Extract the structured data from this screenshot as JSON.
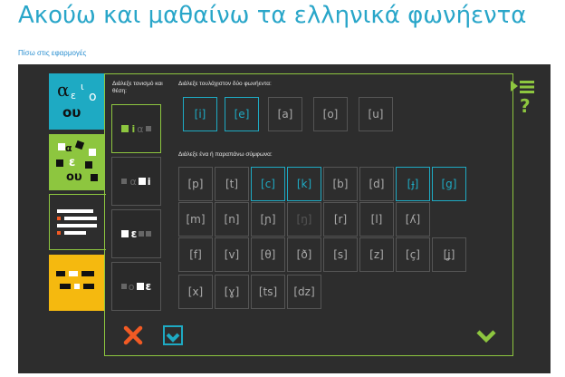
{
  "title": "Ακούω και μαθαίνω τα ελληνικά φωνήεντα",
  "back_link": "Πίσω στις εφαρμογές",
  "accent_label": "Διάλεξε τονισμό και θέση:",
  "vowels_label": "Διάλεξε τουλάχιστον δύο φωνήεντα:",
  "consonants_label": "Διάλεξε ένα ή παραπάνω σύμφωνα:",
  "tile1": {
    "line1": "α",
    "line2": "ε",
    "line3": "ι",
    "line4": "ο",
    "line5": "ου"
  },
  "tile2": {
    "a": "α",
    "b": "ε",
    "c": "ου"
  },
  "accent_options": [
    {
      "text": "i",
      "mid": "α",
      "selected": true
    },
    {
      "text": "α",
      "mid": "i",
      "selected": false
    },
    {
      "text": "ε",
      "mid": "",
      "selected": false
    },
    {
      "text": "ο",
      "mid": "ε",
      "selected": false
    }
  ],
  "vowels": [
    {
      "label": "[i]",
      "selected": true
    },
    {
      "label": "[e]",
      "selected": true
    },
    {
      "label": "[a]",
      "selected": false
    },
    {
      "label": "[o]",
      "selected": false
    },
    {
      "label": "[u]",
      "selected": false
    }
  ],
  "consonants": [
    [
      {
        "label": "[p]",
        "state": "normal"
      },
      {
        "label": "[t]",
        "state": "normal"
      },
      {
        "label": "[c]",
        "state": "selected"
      },
      {
        "label": "[k]",
        "state": "selected"
      },
      {
        "label": "[b]",
        "state": "normal"
      },
      {
        "label": "[d]",
        "state": "normal"
      },
      {
        "label": "[ɟ]",
        "state": "selected"
      },
      {
        "label": "[g]",
        "state": "selected"
      }
    ],
    [
      {
        "label": "[m]",
        "state": "normal"
      },
      {
        "label": "[n]",
        "state": "normal"
      },
      {
        "label": "[ɲ]",
        "state": "normal"
      },
      {
        "label": "[ŋ]",
        "state": "disabled"
      },
      {
        "label": "[r]",
        "state": "normal"
      },
      {
        "label": "[l]",
        "state": "normal"
      },
      {
        "label": "[ʎ]",
        "state": "normal"
      }
    ],
    [
      {
        "label": "[f]",
        "state": "normal"
      },
      {
        "label": "[v]",
        "state": "normal"
      },
      {
        "label": "[θ]",
        "state": "normal"
      },
      {
        "label": "[ð]",
        "state": "normal"
      },
      {
        "label": "[s]",
        "state": "normal"
      },
      {
        "label": "[z]",
        "state": "normal"
      },
      {
        "label": "[ç]",
        "state": "normal"
      },
      {
        "label": "[ʝ]",
        "state": "normal"
      }
    ],
    [
      {
        "label": "[x]",
        "state": "normal"
      },
      {
        "label": "[ɣ]",
        "state": "normal"
      },
      {
        "label": "[ts]",
        "state": "normal"
      },
      {
        "label": "[dz]",
        "state": "normal"
      }
    ]
  ],
  "colors": {
    "accent_green": "#8dc63f",
    "accent_blue": "#1eaac3",
    "accent_orange": "#f15a24",
    "accent_yellow": "#f5b90f"
  },
  "icons": {
    "menu": "menu-icon",
    "help": "help-icon",
    "cancel": "close-x-icon",
    "confirm": "checkbox-check-icon",
    "next": "chevron-down-icon"
  }
}
